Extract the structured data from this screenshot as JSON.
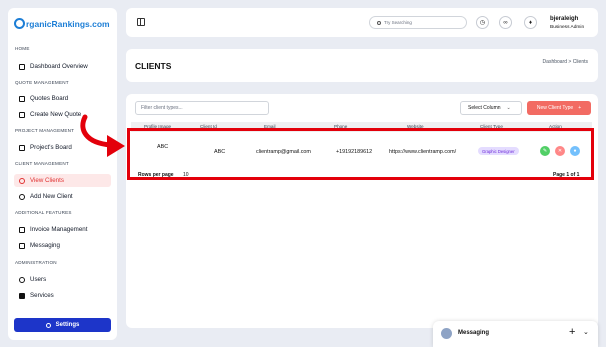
{
  "brand": {
    "logo_text": "rganicRankings.com"
  },
  "sidebar": {
    "sections": [
      {
        "label": "HOME"
      },
      {
        "label": "QUOTE MANAGEMENT"
      },
      {
        "label": "PROJECT MANAGEMENT"
      },
      {
        "label": "CLIENT MANAGEMENT"
      },
      {
        "label": "ADDITIONAL FEATURES"
      },
      {
        "label": "ADMINISTRATION"
      }
    ],
    "items": [
      {
        "label": "Dashboard Overview"
      },
      {
        "label": "Quotes Board"
      },
      {
        "label": "Create New Quote"
      },
      {
        "label": "Project's Board"
      },
      {
        "label": "View Clients"
      },
      {
        "label": "Add New Client"
      },
      {
        "label": "Invoice Management"
      },
      {
        "label": "Messaging"
      },
      {
        "label": "Users"
      },
      {
        "label": "Services"
      }
    ],
    "settings_label": "Settings"
  },
  "topbar": {
    "search_placeholder": "Try Searching",
    "user_name": "bjeraleigh",
    "user_role": "Business Admin"
  },
  "page": {
    "title": "CLIENTS",
    "breadcrumb": "Dashboard  >  Clients"
  },
  "toolbar": {
    "filter_placeholder": "Filter client types...",
    "select_column": "Select Column",
    "new_client_type": "New Client Type"
  },
  "table": {
    "headers": [
      "Profile Image",
      "Client Id",
      "Email",
      "Phone",
      "Website",
      "Client Type",
      "Action"
    ],
    "row": {
      "profile": "ABC",
      "client_id": "ABC",
      "email": "clientramp@gmail.com",
      "phone": "+19192189612",
      "website": "https://www.clientramp.com/",
      "client_type": "Graphic Designer"
    },
    "rows_per_page_label": "Rows per page",
    "rows_per_page_value": "10",
    "page_info": "Page 1 of 1"
  },
  "messaging": {
    "label": "Messaging"
  },
  "colors": {
    "accent": "#1d35c9",
    "danger": "#f26b63",
    "highlight": "#e3000b"
  }
}
